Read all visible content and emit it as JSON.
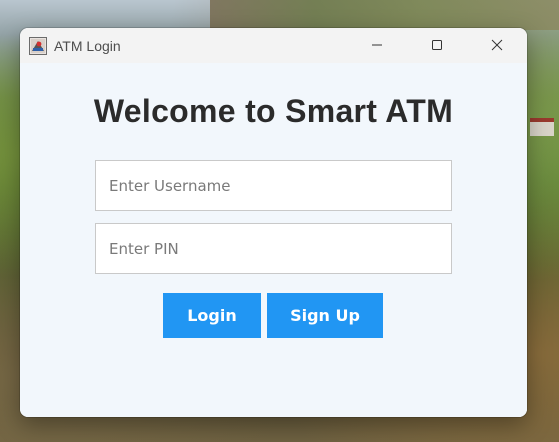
{
  "window": {
    "title": "ATM Login",
    "app_icon": "atm-app-icon",
    "controls": {
      "minimize_icon": "minimize-icon",
      "maximize_icon": "maximize-icon",
      "close_icon": "close-icon"
    }
  },
  "main": {
    "heading": "Welcome to Smart ATM",
    "username_placeholder": "Enter Username",
    "username_value": "",
    "pin_placeholder": "Enter PIN",
    "pin_value": "",
    "login_label": "Login",
    "signup_label": "Sign Up"
  },
  "colors": {
    "button_bg": "#2196f3",
    "button_text": "#ffffff",
    "content_bg": "#f2f7fc",
    "heading_text": "#2b2b2b"
  }
}
